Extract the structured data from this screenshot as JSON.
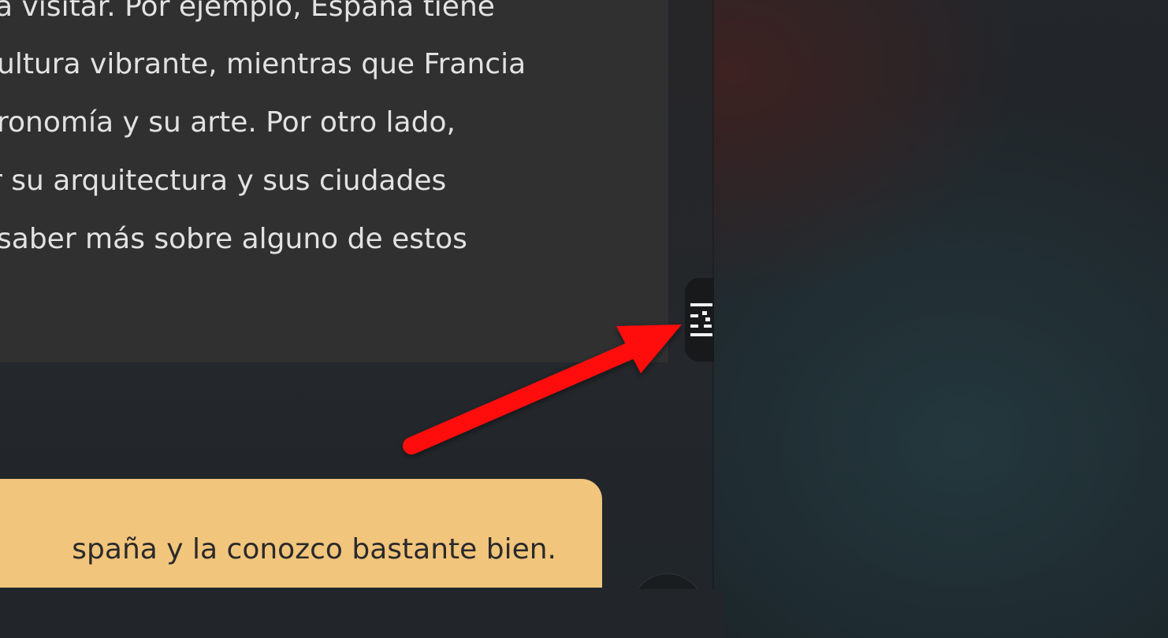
{
  "assistant_message": {
    "lines": [
      "a visitar. Por ejemplo, España tiene",
      "ultura vibrante, mientras que Francia",
      "ronomía y su arte. Por otro lado,",
      "r su arquitectura y sus ciudades",
      "saber más sobre alguno de estos"
    ]
  },
  "user_message": {
    "text": "spaña y la conozco bastante bien."
  },
  "side_toggle": {
    "icon": "list-collapse-icon"
  },
  "annotation": {
    "arrow_color": "#ff0a0a"
  },
  "colors": {
    "assistant_bubble": "#303030",
    "user_bubble": "#f2c57c",
    "text_light": "#e2e2e2",
    "text_dark": "#2a2a2a"
  }
}
